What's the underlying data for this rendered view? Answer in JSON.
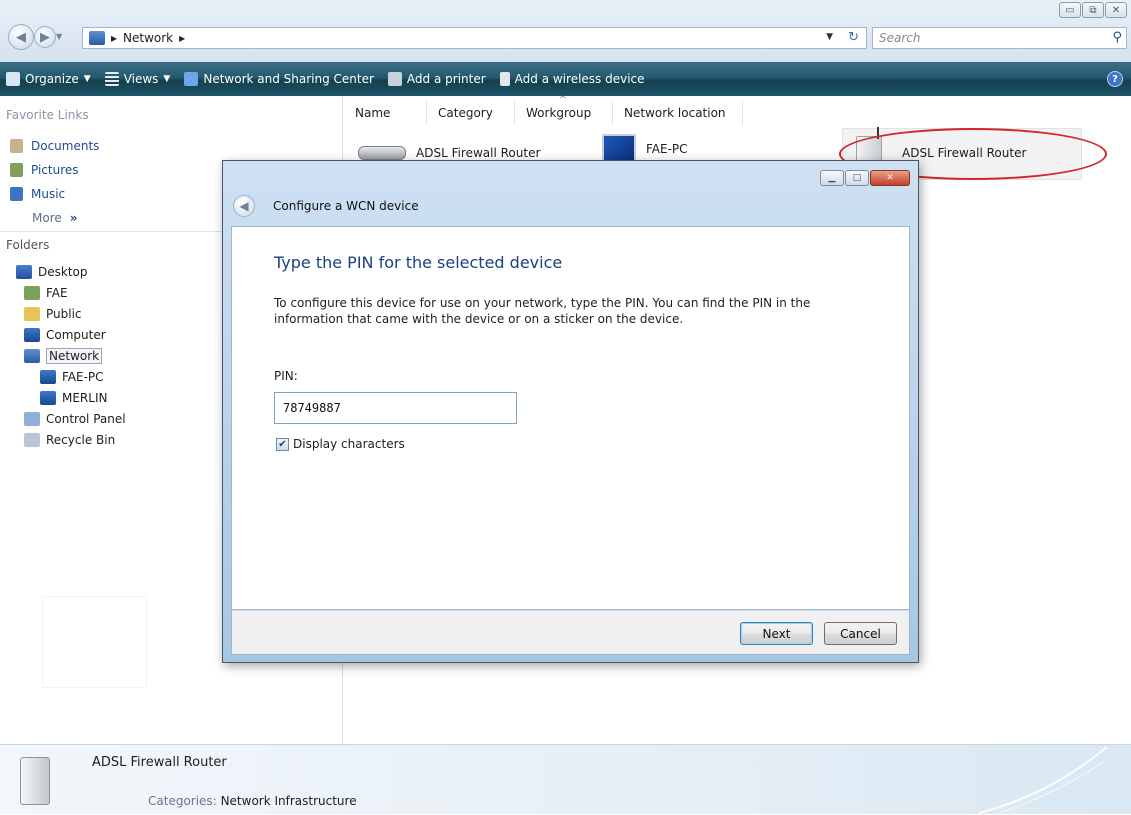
{
  "window": {
    "caption_buttons": [
      "▭",
      "⧉",
      "✕"
    ]
  },
  "address": {
    "crumbs": [
      "Network"
    ],
    "search_placeholder": "Search"
  },
  "toolbar": {
    "organize": "Organize",
    "views": "Views",
    "network_sharing": "Network and Sharing Center",
    "add_printer": "Add a printer",
    "add_wireless": "Add a wireless device",
    "help": "?"
  },
  "sidebar": {
    "favorites_title": "Favorite Links",
    "favorites": [
      {
        "label": "Documents",
        "icon": "documents-icon"
      },
      {
        "label": "Pictures",
        "icon": "pictures-icon"
      },
      {
        "label": "Music",
        "icon": "music-icon"
      }
    ],
    "more": "More",
    "folders_title": "Folders",
    "tree": [
      {
        "label": "Desktop",
        "icon": "desktop-icon"
      },
      {
        "label": "FAE",
        "icon": "user-folder-icon"
      },
      {
        "label": "Public",
        "icon": "folder-icon"
      },
      {
        "label": "Computer",
        "icon": "computer-icon"
      },
      {
        "label": "Network",
        "icon": "network-icon"
      },
      {
        "label": "FAE-PC",
        "icon": "computer-icon"
      },
      {
        "label": "MERLIN",
        "icon": "computer-icon"
      },
      {
        "label": "Control Panel",
        "icon": "control-panel-icon"
      },
      {
        "label": "Recycle Bin",
        "icon": "recycle-bin-icon"
      }
    ]
  },
  "columns": [
    "Name",
    "Category",
    "Workgroup",
    "Network location"
  ],
  "items": [
    {
      "label": "ADSL Firewall Router"
    },
    {
      "label": "FAE-PC"
    },
    {
      "label": "ADSL Firewall Router"
    }
  ],
  "details": {
    "name": "ADSL Firewall Router",
    "categories_label": "Categories:",
    "categories_value": "Network Infrastructure"
  },
  "dialog": {
    "title": "Configure a WCN device",
    "heading": "Type the PIN for the selected device",
    "description": "To configure this device for use on your network, type the PIN. You can find the PIN in the information that came with the device or on a sticker on the device.",
    "pin_label": "PIN:",
    "pin_value": "78749887",
    "display_chars_label": "Display characters",
    "display_chars_checked": true,
    "next": "Next",
    "cancel": "Cancel"
  },
  "colors": {
    "toolbar": "#245a70",
    "highlight_ellipse": "#d1262b",
    "dialog_frame": "#a8c6e4"
  }
}
